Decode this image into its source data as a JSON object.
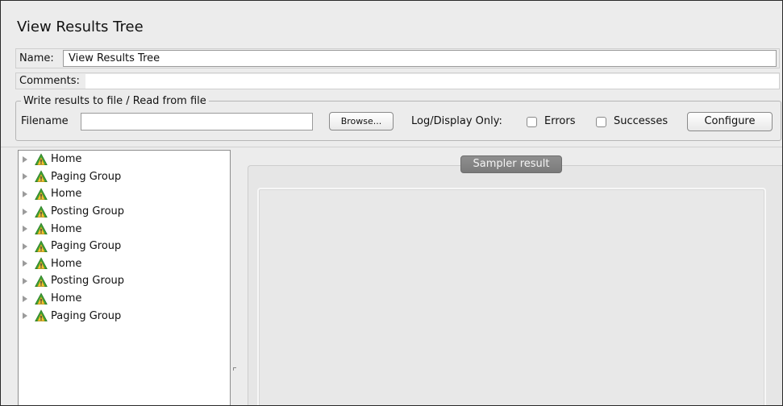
{
  "panel": {
    "title": "View Results Tree"
  },
  "name_row": {
    "label": "Name:",
    "value": "View Results Tree"
  },
  "comments_row": {
    "label": "Comments:",
    "value": ""
  },
  "file_group": {
    "legend": "Write results to file / Read from file",
    "filename_label": "Filename",
    "filename_value": "",
    "browse_label": "Browse...",
    "log_display_label": "Log/Display Only:",
    "errors_label": "Errors",
    "errors_checked": false,
    "successes_label": "Successes",
    "successes_checked": false,
    "configure_label": "Configure"
  },
  "tree": {
    "item_icon": "success-warning-triangle-icon",
    "items": [
      {
        "label": "Home"
      },
      {
        "label": "Paging Group"
      },
      {
        "label": "Home"
      },
      {
        "label": "Posting Group"
      },
      {
        "label": "Home"
      },
      {
        "label": "Paging Group"
      },
      {
        "label": "Home"
      },
      {
        "label": "Posting Group"
      },
      {
        "label": "Home"
      },
      {
        "label": "Paging Group"
      }
    ]
  },
  "result_panel": {
    "tab_label": "Sampler result"
  },
  "colors": {
    "background": "#ececec",
    "icon_green": "#3fa335",
    "icon_yellow": "#f5c431",
    "tab_gray": "#858585"
  }
}
